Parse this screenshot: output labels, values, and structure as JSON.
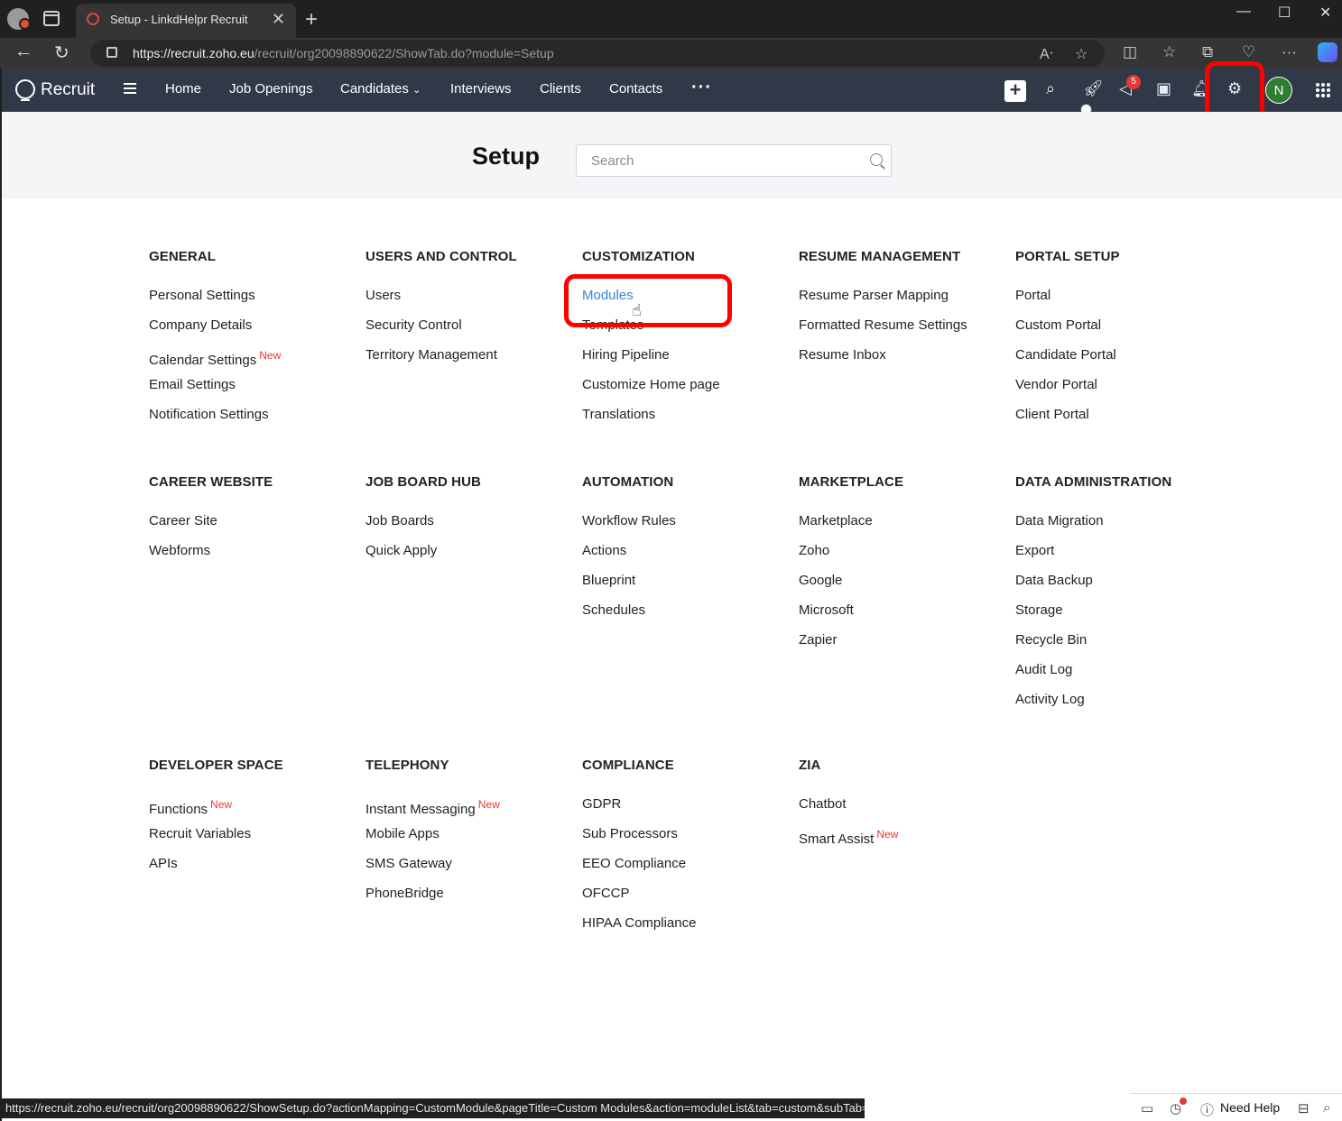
{
  "browser": {
    "tab_title": "Setup - LinkdHelpr Recruit",
    "url_host": "https://recruit.zoho.eu",
    "url_path": "/recruit/org20098890622/ShowTab.do?module=Setup",
    "status_url": "https://recruit.zoho.eu/recruit/org20098890622/ShowSetup.do?actionMapping=CustomModule&pageTitle=Custom Modules&action=moduleList&tab=custom&subTab=modules"
  },
  "app": {
    "logo_text": "Recruit",
    "nav": [
      "Home",
      "Job Openings",
      "Candidates",
      "Interviews",
      "Clients",
      "Contacts"
    ],
    "notification_count": "5",
    "avatar_initial": "N"
  },
  "setup": {
    "title": "Setup",
    "search_placeholder": "Search",
    "new_label": "New",
    "sections": {
      "general": {
        "title": "GENERAL",
        "items": [
          "Personal Settings",
          "Company Details",
          "Calendar Settings",
          "Email Settings",
          "Notification Settings"
        ]
      },
      "users": {
        "title": "USERS AND CONTROL",
        "items": [
          "Users",
          "Security Control",
          "Territory Management"
        ]
      },
      "customization": {
        "title": "CUSTOMIZATION",
        "items": [
          "Modules",
          "Templates",
          "Hiring Pipeline",
          "Customize Home page",
          "Translations"
        ]
      },
      "resume": {
        "title": "RESUME MANAGEMENT",
        "items": [
          "Resume Parser Mapping",
          "Formatted Resume Settings",
          "Resume Inbox"
        ]
      },
      "portal": {
        "title": "PORTAL SETUP",
        "items": [
          "Portal",
          "Custom Portal",
          "Candidate Portal",
          "Vendor Portal",
          "Client Portal"
        ]
      },
      "career": {
        "title": "CAREER WEBSITE",
        "items": [
          "Career Site",
          "Webforms"
        ]
      },
      "jobboard": {
        "title": "JOB BOARD HUB",
        "items": [
          "Job Boards",
          "Quick Apply"
        ]
      },
      "automation": {
        "title": "AUTOMATION",
        "items": [
          "Workflow Rules",
          "Actions",
          "Blueprint",
          "Schedules"
        ]
      },
      "marketplace": {
        "title": "MARKETPLACE",
        "items": [
          "Marketplace",
          "Zoho",
          "Google",
          "Microsoft",
          "Zapier"
        ]
      },
      "data": {
        "title": "DATA ADMINISTRATION",
        "items": [
          "Data Migration",
          "Export",
          "Data Backup",
          "Storage",
          "Recycle Bin",
          "Audit Log",
          "Activity Log"
        ]
      },
      "developer": {
        "title": "DEVELOPER SPACE",
        "items": [
          "Functions",
          "Recruit Variables",
          "APIs"
        ]
      },
      "telephony": {
        "title": "TELEPHONY",
        "items": [
          "Instant Messaging",
          "Mobile Apps",
          "SMS Gateway",
          "PhoneBridge"
        ]
      },
      "compliance": {
        "title": "COMPLIANCE",
        "items": [
          "GDPR",
          "Sub Processors",
          "EEO Compliance",
          "OFCCP",
          "HIPAA Compliance"
        ]
      },
      "zia": {
        "title": "ZIA",
        "items": [
          "Chatbot",
          "Smart Assist"
        ]
      }
    }
  },
  "footer": {
    "need_help": "Need Help"
  }
}
